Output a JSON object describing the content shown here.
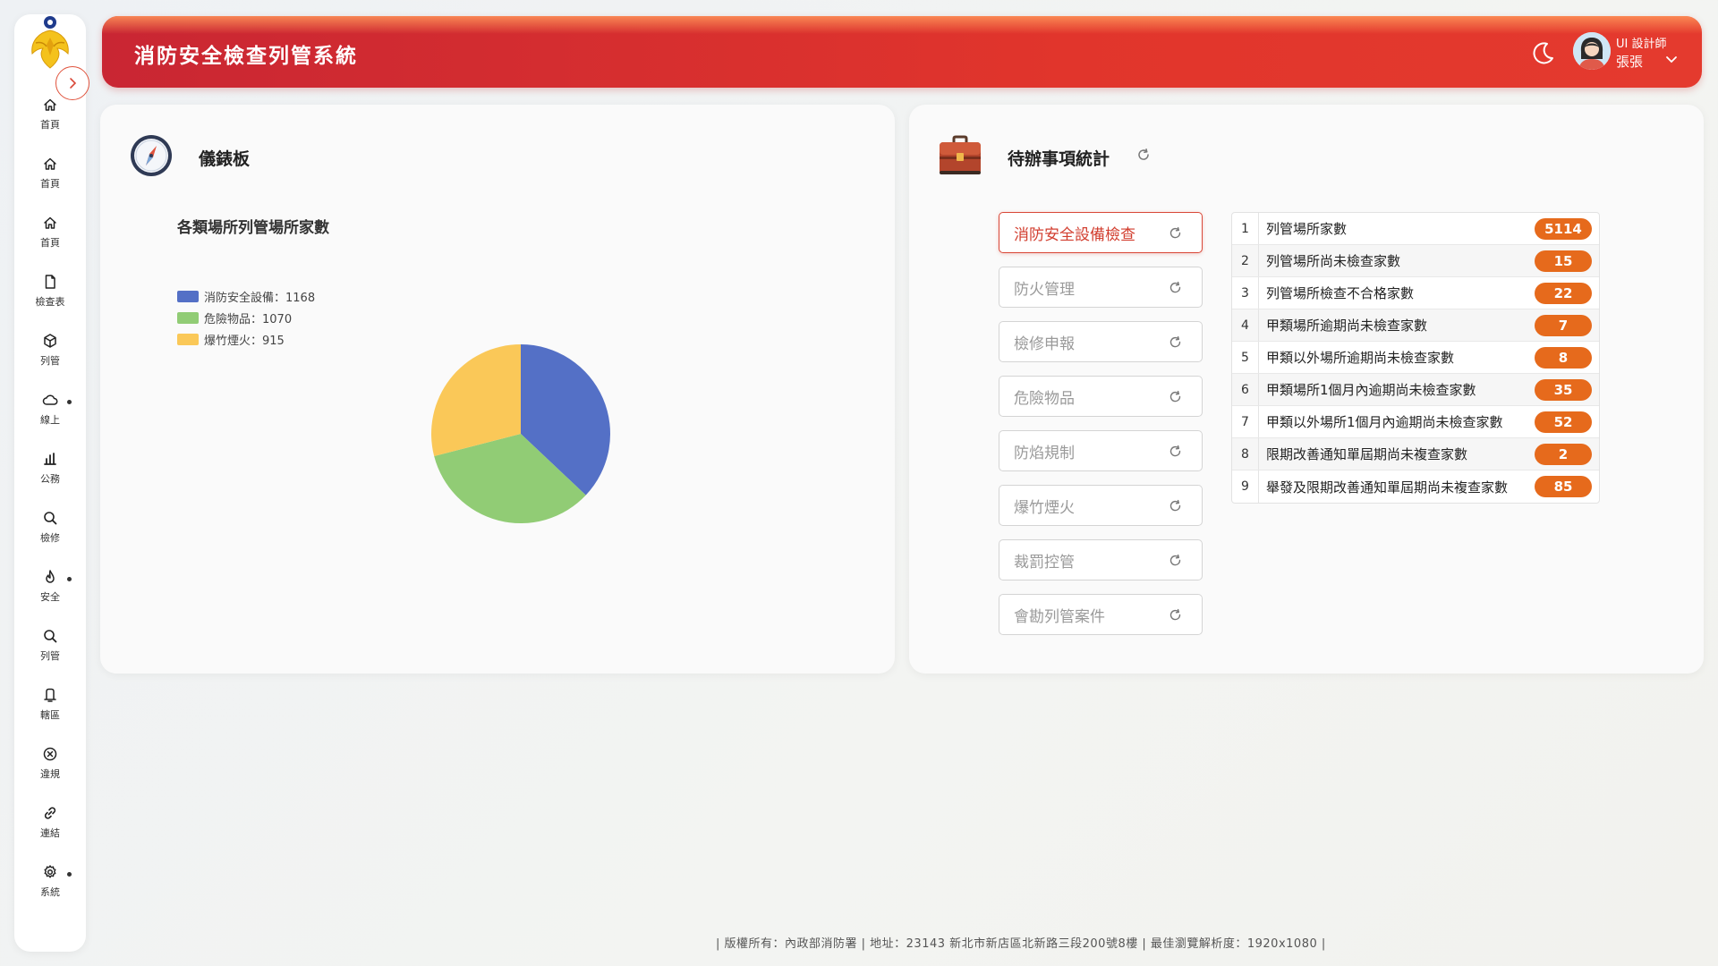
{
  "app": {
    "title": "消防安全檢查列管系統"
  },
  "header": {
    "user_role": "UI 設計師",
    "user_name": "張張"
  },
  "sidebar": {
    "items": [
      {
        "label": "首頁",
        "icon": "home-icon"
      },
      {
        "label": "首頁",
        "icon": "home-icon"
      },
      {
        "label": "首頁",
        "icon": "home-icon"
      },
      {
        "label": "檢查表",
        "icon": "document-icon"
      },
      {
        "label": "列管",
        "icon": "cube-icon"
      },
      {
        "label": "線上",
        "icon": "cloud-icon",
        "has_dot": true
      },
      {
        "label": "公務",
        "icon": "bar-chart-icon"
      },
      {
        "label": "檢修",
        "icon": "search-icon"
      },
      {
        "label": "安全",
        "icon": "flame-icon",
        "has_dot": true
      },
      {
        "label": "列管",
        "icon": "search-icon"
      },
      {
        "label": "轄區",
        "icon": "bell-icon"
      },
      {
        "label": "違規",
        "icon": "x-circle-icon"
      },
      {
        "label": "連結",
        "icon": "link-icon"
      },
      {
        "label": "系統",
        "icon": "gear-icon",
        "has_dot": true
      }
    ]
  },
  "dashboard": {
    "title": "儀錶板",
    "chart_title": "各類場所列管場所家數"
  },
  "chart_data": {
    "type": "pie",
    "title": "各類場所列管場所家數",
    "series": [
      {
        "name": "消防安全設備",
        "value": 1168,
        "color": "#5470c6",
        "legend": "消防安全設備：1168"
      },
      {
        "name": "危險物品",
        "value": 1070,
        "color": "#91cc75",
        "legend": "危險物品：1070"
      },
      {
        "name": "爆竹煙火",
        "value": 915,
        "color": "#fac858",
        "legend": "爆竹煙火：915"
      }
    ],
    "legend_position": "top-left",
    "start_angle_deg": 0,
    "direction": "clockwise"
  },
  "todo": {
    "title": "待辦事項統計",
    "categories": [
      {
        "label": "消防安全設備檢查",
        "active": true
      },
      {
        "label": "防火管理",
        "active": false
      },
      {
        "label": "檢修申報",
        "active": false
      },
      {
        "label": "危險物品",
        "active": false
      },
      {
        "label": "防焰規制",
        "active": false
      },
      {
        "label": "爆竹煙火",
        "active": false
      },
      {
        "label": "裁罰控管",
        "active": false
      },
      {
        "label": "會勘列管案件",
        "active": false
      }
    ],
    "stats": [
      {
        "index": "1",
        "label": "列管場所家數",
        "count": "5114"
      },
      {
        "index": "2",
        "label": "列管場所尚未檢查家數",
        "count": "15"
      },
      {
        "index": "3",
        "label": "列管場所檢查不合格家數",
        "count": "22"
      },
      {
        "index": "4",
        "label": "甲類場所逾期尚未檢查家數",
        "count": "7"
      },
      {
        "index": "5",
        "label": "甲類以外場所逾期尚未檢查家數",
        "count": "8"
      },
      {
        "index": "6",
        "label": "甲類場所1個月內逾期尚未檢查家數",
        "count": "35"
      },
      {
        "index": "7",
        "label": "甲類以外場所1個月內逾期尚未檢查家數",
        "count": "52"
      },
      {
        "index": "8",
        "label": "限期改善通知單屆期尚未複查家數",
        "count": "2"
      },
      {
        "index": "9",
        "label": "舉發及限期改善通知單屆期尚未複查家數",
        "count": "85"
      }
    ]
  },
  "footer": {
    "text": "| 版權所有：內政部消防署 | 地址：23143 新北市新店區北新路三段200號8樓 | 最佳瀏覽解析度：1920x1080 |"
  },
  "colors": {
    "header_red": "#d92d2f",
    "accent_orange": "#e66a1c",
    "active_border": "#d94838"
  }
}
